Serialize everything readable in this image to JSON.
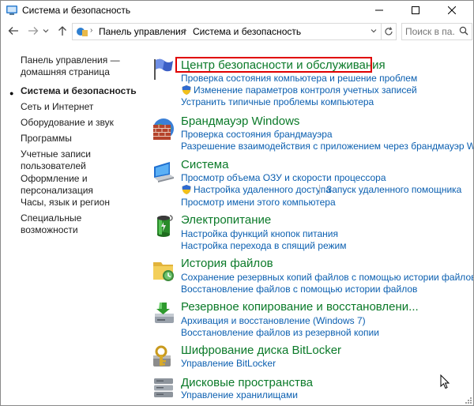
{
  "window": {
    "title": "Система и безопасность"
  },
  "nav": {
    "breadcrumbs": [
      "Панель управления",
      "Система и безопасность"
    ],
    "search_placeholder": "Поиск в па..."
  },
  "sidebar": {
    "items": [
      {
        "label": "Панель управления — домашняя страница"
      },
      {
        "label": "Система и безопасность"
      },
      {
        "label": "Сеть и Интернет"
      },
      {
        "label": "Оборудование и звук"
      },
      {
        "label": "Программы"
      },
      {
        "label": "Учетные записи пользователей"
      },
      {
        "label": "Оформление и персонализация"
      },
      {
        "label": "Часы, язык и регион"
      },
      {
        "label": "Специальные возможности"
      }
    ]
  },
  "categories": [
    {
      "title": "Центр безопасности и обслуживания",
      "icon": "flag-icon",
      "links": [
        "Проверка состояния компьютера и решение проблем",
        "Изменение параметров контроля учетных записей",
        "Устранить типичные проблемы компьютера"
      ]
    },
    {
      "title": "Брандмауэр Windows",
      "icon": "firewall-icon",
      "links": [
        "Проверка состояния брандмауэра",
        "Разрешение взаимодействия с приложением через брандмауэр Wind"
      ]
    },
    {
      "title": "Система",
      "icon": "computer-icon",
      "links": [
        "Просмотр объема ОЗУ и скорости процессора",
        "Настройка удаленного доступа",
        "Запуск удаленного помощника",
        "Просмотр имени этого компьютера"
      ]
    },
    {
      "title": "Электропитание",
      "icon": "battery-icon",
      "links": [
        "Настройка функций кнопок питания",
        "Настройка перехода в спящий режим"
      ]
    },
    {
      "title": "История файлов",
      "icon": "file-history-icon",
      "links": [
        "Сохранение резервных копий файлов с помощью истории файлов",
        "Восстановление файлов с помощью истории файлов"
      ]
    },
    {
      "title": "Резервное копирование и восстановлени...",
      "icon": "backup-icon",
      "links": [
        "Архивация и восстановление (Windows 7)",
        "Восстановление файлов из резервной копии"
      ]
    },
    {
      "title": "Шифрование диска BitLocker",
      "icon": "bitlocker-icon",
      "links": [
        "Управление BitLocker"
      ]
    },
    {
      "title": "Дисковые пространства",
      "icon": "storage-spaces-icon",
      "links": [
        "Управление хранилищами"
      ]
    }
  ],
  "colors": {
    "category_title": "#0b7a29",
    "link": "#0b5fb0",
    "highlight": "#e00000"
  }
}
